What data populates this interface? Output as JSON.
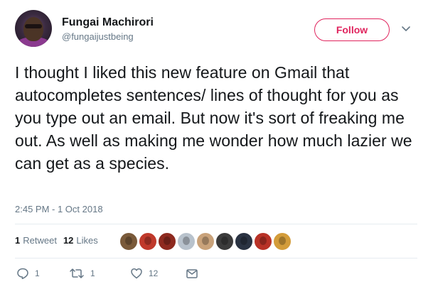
{
  "user": {
    "name": "Fungai Machirori",
    "handle": "@fungaijustbeing"
  },
  "follow_button": {
    "label": "Follow"
  },
  "tweet": {
    "text": "I thought I liked this new feature on Gmail that autocompletes sentences/ lines of thought for you as you type out an email. But now it's sort of freaking me out. As well as making me wonder how much lazier we can get as a species.",
    "timestamp": "2:45 PM - 1 Oct 2018"
  },
  "stats": {
    "retweets_count": "1",
    "retweets_label": "Retweet",
    "likes_count": "12",
    "likes_label": "Likes"
  },
  "likers": [
    {
      "color": "#7a5a3a"
    },
    {
      "color": "#c0392b"
    },
    {
      "color": "#8e2a1f"
    },
    {
      "color": "#b8c2cc"
    },
    {
      "color": "#c9a27a"
    },
    {
      "color": "#3b3b3b"
    },
    {
      "color": "#2a3342"
    },
    {
      "color": "#b83227"
    },
    {
      "color": "#d39c3a"
    }
  ],
  "actions": {
    "reply_count": "1",
    "retweet_count": "1",
    "like_count": "12"
  },
  "colors": {
    "accent": "#e0245e",
    "muted": "#657786",
    "text": "#14171a",
    "divider": "#e6ecf0"
  }
}
